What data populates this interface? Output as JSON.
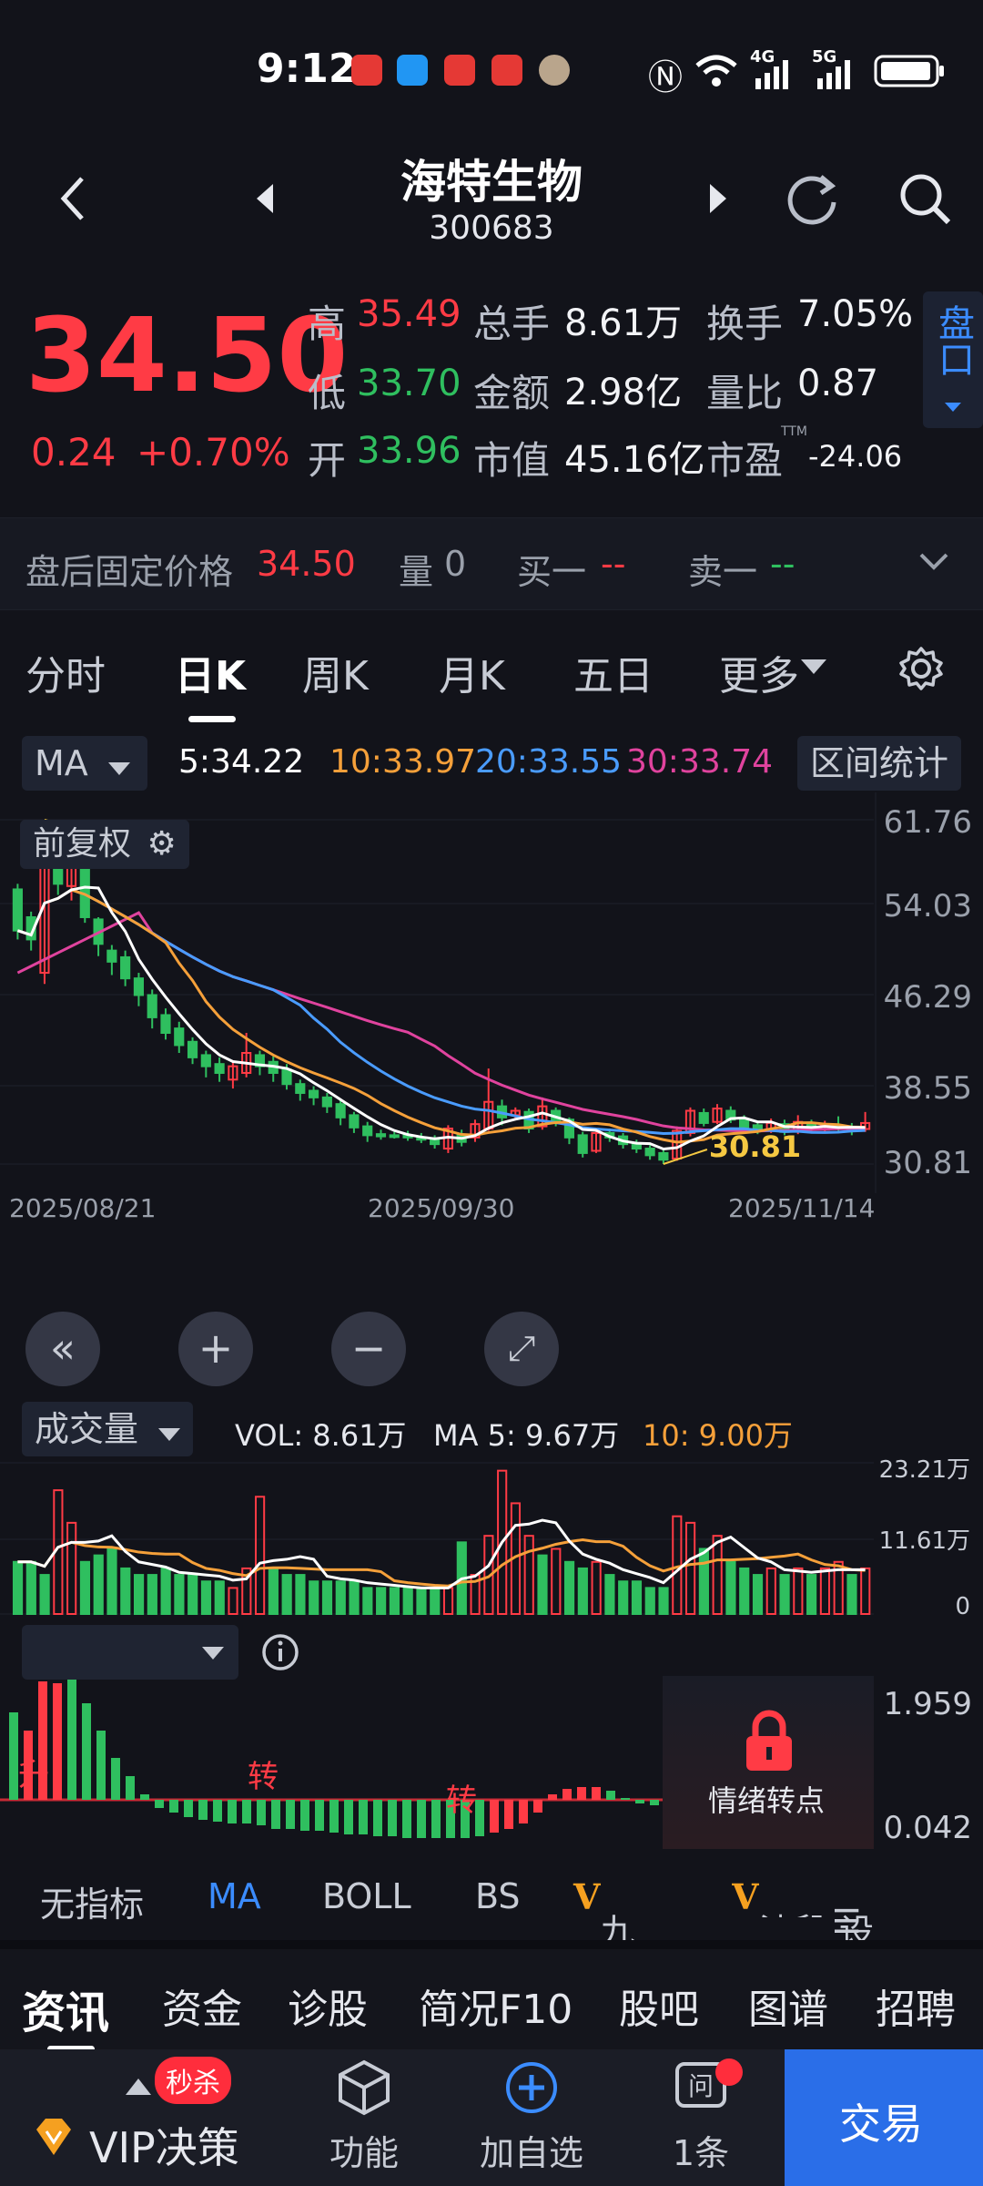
{
  "status": {
    "time": "9:12",
    "network_4g": "4G",
    "network_5g": "5G"
  },
  "header": {
    "stock_name": "海特生物",
    "stock_code": "300683"
  },
  "quote": {
    "price": "34.50",
    "change": "0.24",
    "change_pct": "+0.70%",
    "high_label": "高",
    "high": "35.49",
    "low_label": "低",
    "low": "33.70",
    "open_label": "开",
    "open": "33.96",
    "vol_label": "总手",
    "vol": "8.61万",
    "amount_label": "金额",
    "amount": "2.98亿",
    "mcap_label": "市值",
    "mcap": "45.16亿",
    "turnover_label": "换手",
    "turnover": "7.05%",
    "vol_ratio_label": "量比",
    "vol_ratio": "0.87",
    "pe_label": "市盈",
    "pe_sup": "TTM",
    "pe": "-24.06",
    "pankou": "盘口"
  },
  "after_hours": {
    "label": "盘后固定价格",
    "price": "34.50",
    "qty_label": "量",
    "qty": "0",
    "buy1_label": "买一",
    "buy1": "--",
    "sell1_label": "卖一",
    "sell1": "--"
  },
  "tabs": [
    "分时",
    "日K",
    "周K",
    "月K",
    "五日",
    "更多"
  ],
  "ma_row": {
    "selector": "MA",
    "ma5": "5:34.22",
    "ma10": "10:33.97",
    "ma20": "20:33.55",
    "ma30": "30:33.74",
    "range_stats": "区间统计"
  },
  "kchart": {
    "adjust_label": "前复权",
    "y_ticks": [
      "61.76",
      "54.03",
      "46.29",
      "38.55",
      "30.81"
    ],
    "dates": [
      "2025/08/21",
      "2025/09/30",
      "2025/11/14"
    ],
    "max_marker": "61.76",
    "min_marker": "30.81"
  },
  "volume": {
    "selector": "成交量",
    "vol": "VOL: 8.61万",
    "ma5": "MA 5: 9.67万",
    "ma10": "10: 9.00万",
    "y_ticks": [
      "23.21万",
      "11.61万",
      "0"
    ]
  },
  "indicator": {
    "y_ticks": [
      "1.959",
      "0.042"
    ],
    "markers": [
      "升",
      "转",
      "转"
    ],
    "locked_label": "情绪转点"
  },
  "indicator_tabs": [
    "无指标",
    "MA",
    "BOLL",
    "BS",
    "九转",
    "波段",
    "设置"
  ],
  "news_tabs": [
    "资讯",
    "资金",
    "诊股",
    "简况F10",
    "股吧",
    "图谱",
    "招聘"
  ],
  "bottom": {
    "vip_badge": "秒杀",
    "vip": "VIP决策",
    "func": "功能",
    "add": "加自选",
    "ask": "1条",
    "trade": "交易"
  },
  "colors": {
    "up": "#ff3b45",
    "down": "#2fbf5f",
    "ma5": "#ffffff",
    "ma10": "#f5a03a",
    "ma20": "#4a9cff",
    "ma30": "#e0439e",
    "accent": "#3b8cff"
  }
}
